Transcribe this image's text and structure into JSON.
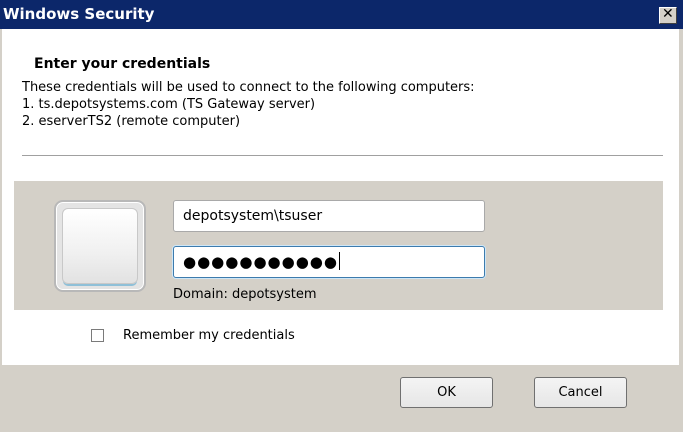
{
  "window": {
    "title": "Windows Security",
    "close_glyph": "✕"
  },
  "content": {
    "heading": "Enter your credentials",
    "description_lines": [
      "These credentials will be used to connect to the following computers:",
      "1. ts.depotsystems.com (TS Gateway server)",
      "2. eserverTS2 (remote computer)"
    ]
  },
  "credentials": {
    "username_value": "depotsystem\\tsuser",
    "password_masked": "●●●●●●●●●●●",
    "domain_text": "Domain: depotsystem"
  },
  "remember": {
    "label": "Remember my credentials",
    "checked": false
  },
  "buttons": {
    "ok": "OK",
    "cancel": "Cancel"
  }
}
